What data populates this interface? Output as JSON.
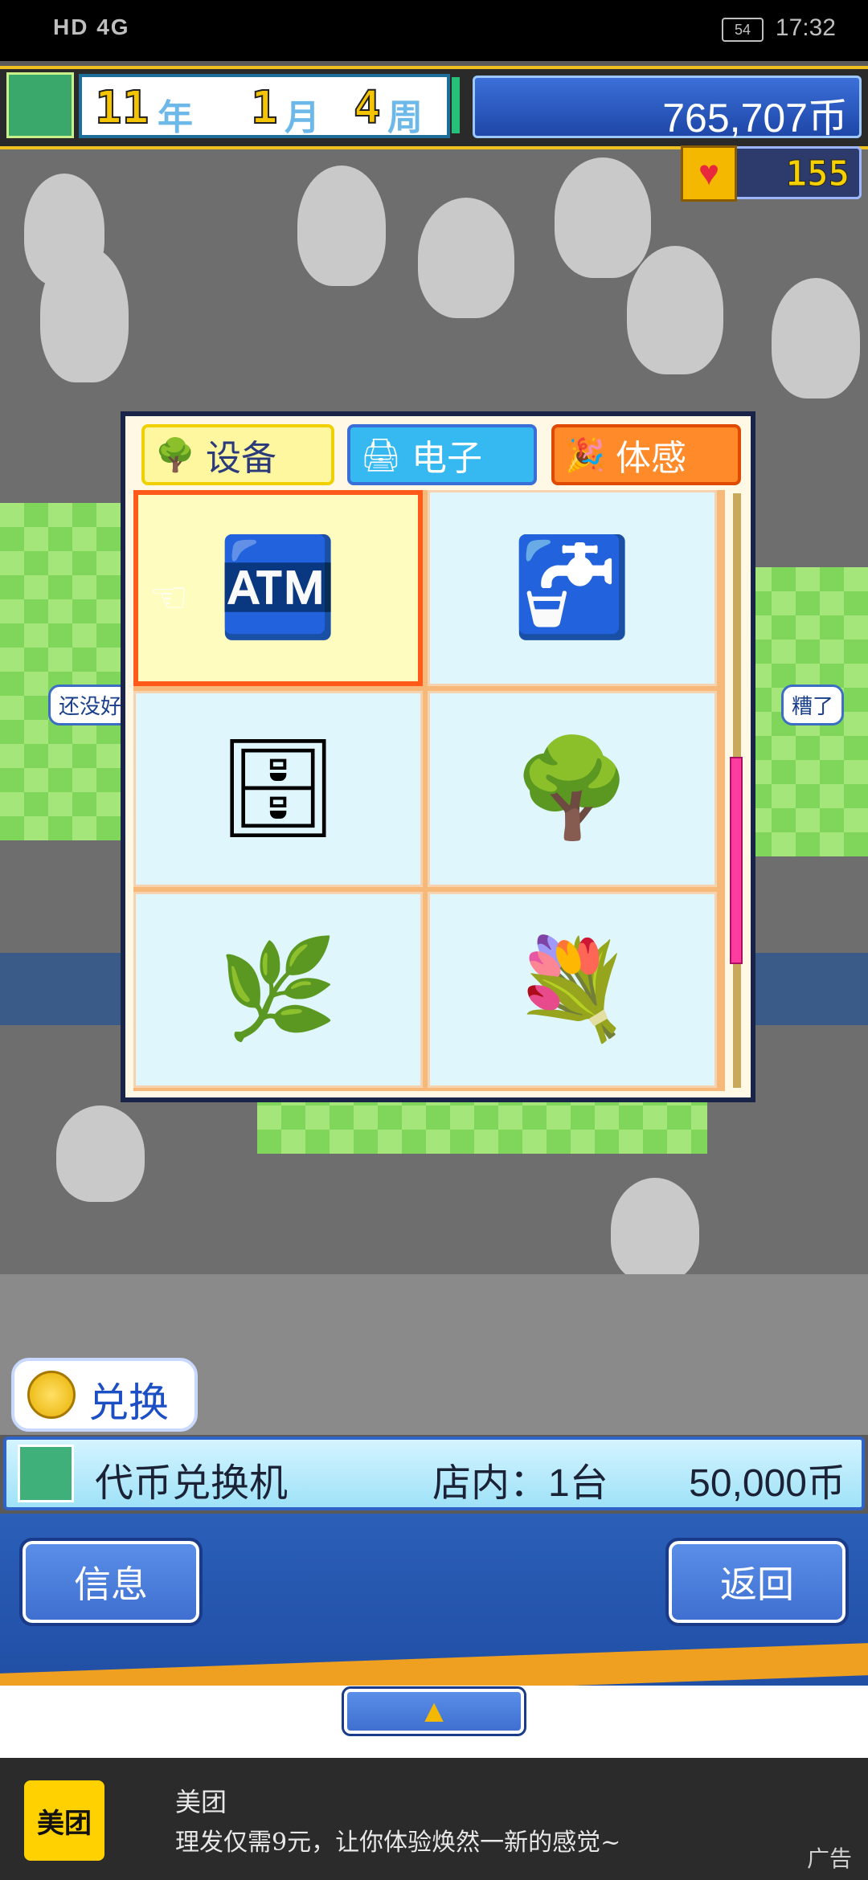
{
  "status_bar": {
    "network": "HD 4G",
    "battery": "54",
    "time": "17:32"
  },
  "hud": {
    "year_value": "11",
    "year_unit": "年",
    "month_value": "1",
    "month_unit": "月",
    "week_value": "4",
    "week_unit": "周",
    "money": "765,707币",
    "hearts": "155"
  },
  "bubbles": {
    "left": "还没好",
    "right": "糟了"
  },
  "panel": {
    "tabs": [
      {
        "label": "设备",
        "icon": "tree-bench-icon"
      },
      {
        "label": "电子",
        "icon": "register-icon"
      },
      {
        "label": "体感",
        "icon": "party-popper-icon"
      }
    ],
    "items": [
      {
        "icon": "token-exchange-machine-icon",
        "selected": true
      },
      {
        "icon": "water-dispenser-icon",
        "selected": false
      },
      {
        "icon": "lockers-icon",
        "selected": false
      },
      {
        "icon": "trees-icon",
        "selected": false
      },
      {
        "icon": "hedge-planter-icon",
        "selected": false
      },
      {
        "icon": "flower-vase-icon",
        "selected": false
      }
    ]
  },
  "exchange_button": {
    "label": "兑换"
  },
  "item_info": {
    "name": "代币兑换机",
    "count": "店内：1台",
    "price": "50,000币"
  },
  "controls": {
    "info_label": "信息",
    "back_label": "返回",
    "up_arrow": "▲"
  },
  "ad": {
    "logo": "美团",
    "title": "美团",
    "description": "理发仅需9元，让你体验焕然一新的感觉~",
    "tag": "广告"
  },
  "colors": {
    "selected_border": "#ff5a1a",
    "panel_border": "#1a2448",
    "money_bg": "#1e47a8",
    "floor_green": "#7fd65a"
  }
}
